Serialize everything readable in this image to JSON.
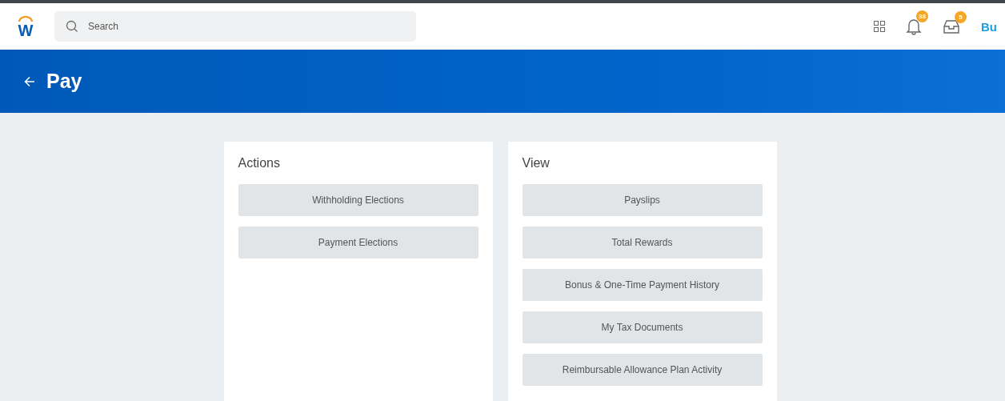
{
  "header": {
    "logo": "W",
    "search": {
      "placeholder": "Search"
    },
    "notifications": {
      "count": "38"
    },
    "inbox": {
      "count": "5"
    },
    "profile": {
      "initials": "Bu"
    }
  },
  "banner": {
    "title": "Pay"
  },
  "cards": [
    {
      "title": "Actions",
      "buttons": [
        "Withholding Elections",
        "Payment Elections"
      ]
    },
    {
      "title": "View",
      "buttons": [
        "Payslips",
        "Total Rewards",
        "Bonus & One-Time Payment History",
        "My Tax Documents",
        "Reimbursable Allowance Plan Activity"
      ]
    }
  ]
}
